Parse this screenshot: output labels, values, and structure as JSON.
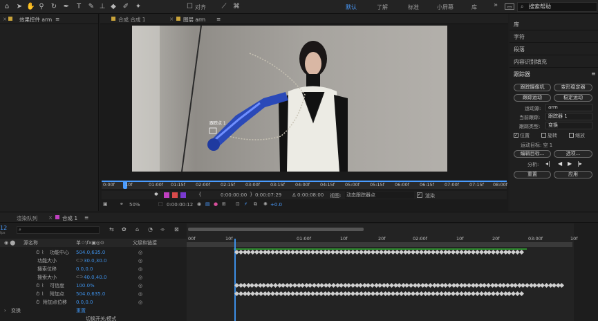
{
  "toolbar": {
    "snap_label": "对齐",
    "workspaces": [
      "默认",
      "了解",
      "标准",
      "小屏幕",
      "库"
    ],
    "overflow": "»",
    "search_placeholder": "搜索帮助"
  },
  "left_panel": {
    "tab_label": "效果控件 arm",
    "menu_icon": "≡"
  },
  "viewer": {
    "tab_comp": "合成 合成 1",
    "tab_layer": "图层 arm",
    "menu_icon": "≡",
    "overlay_label": "跟踪点 1",
    "ruler_ticks": [
      "0:00f",
      "10f",
      "01:00f",
      "01:15f",
      "02:00f",
      "02:15f",
      "03:00f",
      "03:15f",
      "04:00f",
      "04:15f",
      "05:00f",
      "05:15f",
      "06:00f",
      "06:15f",
      "07:00f",
      "07:15f",
      "08:00f"
    ],
    "in_time": "0:00:00:00",
    "out_time": "0:00:07:29",
    "duration": "Δ 0:00:08:00",
    "view_label": "视图:",
    "view_value": "动态跟踪器点",
    "render_label": "渲染",
    "zoom": "50%",
    "current_time": "0:00:00:12",
    "exposure": "+0.0"
  },
  "right_panel": {
    "items": [
      "库",
      "字符",
      "段落",
      "内容识别填充"
    ],
    "tracker_title": "跟踪器",
    "btn_track_camera": "跟踪摄像机",
    "btn_warp_stabilizer": "变形稳定器",
    "btn_track_motion": "跟踪运动",
    "btn_stabilize_motion": "稳定运动",
    "motion_source_label": "运动源:",
    "motion_source_value": "arm",
    "current_track_label": "当前跟踪:",
    "current_track_value": "跟踪器 1",
    "track_type_label": "跟踪类型:",
    "track_type_value": "变换",
    "cb_position": "位置",
    "cb_rotation": "旋转",
    "cb_scale": "缩放",
    "motion_target": "运动目标: 空 1",
    "btn_edit_target": "编辑目标...",
    "btn_options": "选项...",
    "analyze_label": "分析:",
    "btn_reset": "重置",
    "btn_apply": "应用"
  },
  "timeline": {
    "tab_render_queue": "渲染队列",
    "tab_comp": "合成 1",
    "frame_number": "12",
    "time_sub": "fps",
    "search_placeholder": "",
    "col_source_name": "源名称",
    "col_switches": "单☆\\fx▣◎⊙",
    "col_parent": "父级和链接",
    "ruler": [
      "00f",
      "10f",
      "01:00f",
      "10f",
      "20f",
      "02:00f",
      "10f",
      "20f",
      "03:00f",
      "10f"
    ],
    "layers": [
      {
        "name": "功能中心",
        "value": "504.0,635.0"
      },
      {
        "name": "功能大小",
        "value": "30.0,30.0"
      },
      {
        "name": "搜索位移",
        "value": "0.0,0.0"
      },
      {
        "name": "搜索大小",
        "value": "40.0,40.0"
      },
      {
        "name": "可信度",
        "value": "100.0%"
      },
      {
        "name": "附加点",
        "value": "504.0,635.0"
      },
      {
        "name": "附加点位移",
        "value": "0.0,0.0"
      }
    ],
    "transform_label": "变换",
    "reset_label": "重置",
    "bottom_label": "切换开关/模式"
  },
  "colors": {
    "accent": "#4a9cff",
    "value_blue": "#3d8fe6",
    "panel_bg": "#1f1f1f",
    "work_area_green": "#2e8b2e"
  }
}
